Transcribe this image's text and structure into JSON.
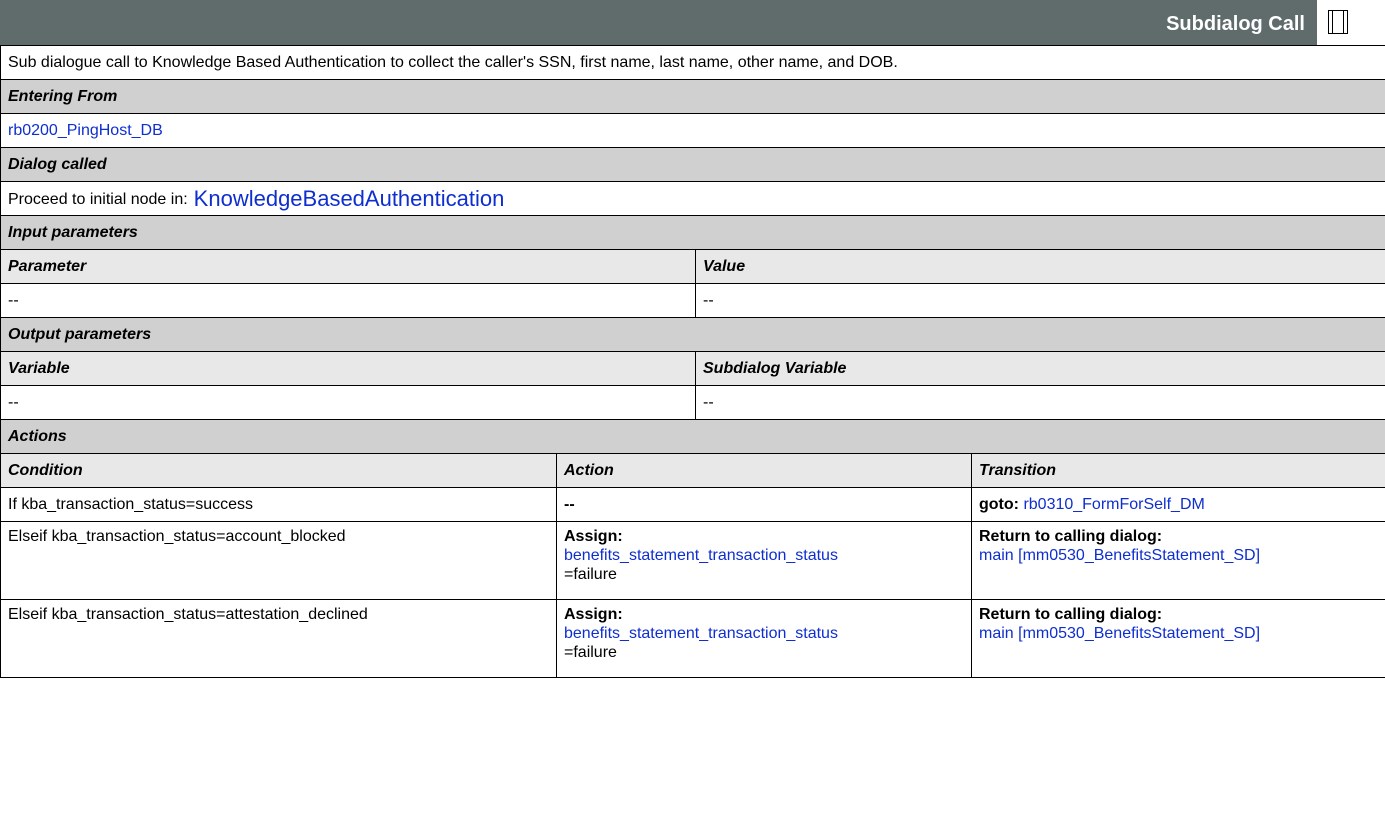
{
  "header": {
    "title": "Subdialog Call",
    "icon": "window-panel-icon"
  },
  "description": "Sub dialogue call to Knowledge Based Authentication to collect the caller's SSN, first name, last name, other name, and DOB.",
  "entering_from": {
    "label": "Entering From",
    "link": "rb0200_PingHost_DB"
  },
  "dialog_called": {
    "label": "Dialog called",
    "prefix": "Proceed to initial node in:",
    "link": "KnowledgeBasedAuthentication"
  },
  "input_parameters": {
    "label": "Input parameters",
    "col_parameter": "Parameter",
    "col_value": "Value",
    "row": {
      "parameter": "--",
      "value": "--"
    }
  },
  "output_parameters": {
    "label": "Output parameters",
    "col_variable": "Variable",
    "col_subdialog_variable": "Subdialog Variable",
    "row": {
      "variable": "--",
      "subdialog_variable": "--"
    }
  },
  "actions": {
    "label": "Actions",
    "col_condition": "Condition",
    "col_action": "Action",
    "col_transition": "Transition",
    "rows": [
      {
        "condition": "If kba_transaction_status=success",
        "action": "--",
        "transition_label": "goto:",
        "transition_link": "rb0310_FormForSelf_DM"
      },
      {
        "condition": "Elseif kba_transaction_status=account_blocked",
        "action_label": "Assign:",
        "action_link": "benefits_statement_transaction_status",
        "action_value": "=failure",
        "transition_label": "Return to calling dialog:",
        "transition_link": "main [mm0530_BenefitsStatement_SD]"
      },
      {
        "condition": "Elseif kba_transaction_status=attestation_declined",
        "action_label": "Assign:",
        "action_link": "benefits_statement_transaction_status",
        "action_value": "=failure",
        "transition_label": "Return to calling dialog:",
        "transition_link": "main [mm0530_BenefitsStatement_SD]"
      }
    ]
  },
  "colors": {
    "header_bg": "#5f6c6b",
    "section_bg": "#d0d0d0",
    "column_header_bg": "#e8e8e8",
    "link": "#0e2ed0"
  }
}
